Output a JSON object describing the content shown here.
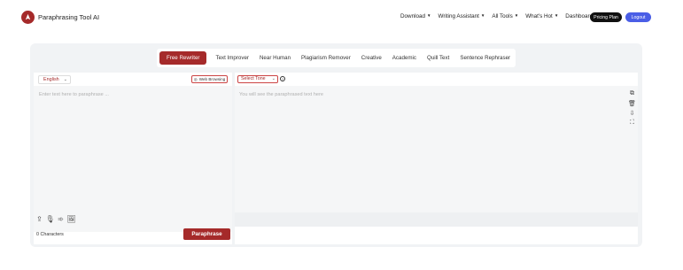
{
  "brand": {
    "name": "Paraphrasing Tool AI"
  },
  "nav": {
    "links": [
      {
        "label": "Download",
        "dropdown": true
      },
      {
        "label": "Writing Assistant",
        "dropdown": true
      },
      {
        "label": "All Tools",
        "dropdown": true
      },
      {
        "label": "What's Hot",
        "dropdown": true
      },
      {
        "label": "Dashboard",
        "dropdown": false
      }
    ],
    "pricing_label": "Pricing Plan",
    "logout_label": "Logout"
  },
  "modes": [
    "Free Rewriter",
    "Text Improver",
    "Near Human",
    "Plagiarism Remover",
    "Creative",
    "Academic",
    "Quill Text",
    "Sentence Rephraser"
  ],
  "active_mode": "Free Rewriter",
  "input": {
    "language": "English",
    "web_browsing_label": "Web Browsing",
    "placeholder": "Enter text here to paraphrase ...",
    "char_count": "0 Characters",
    "paraphrase_label": "Paraphrase"
  },
  "output": {
    "tone_label": "Select Tone",
    "placeholder": "You will see the paraphrased text here"
  },
  "colors": {
    "accent": "#a52a2a",
    "logout": "#4a5ee6",
    "pricing": "#111111"
  },
  "icons": {
    "input_tools": [
      "upload-icon",
      "microphone-icon",
      "arrow-right-icon",
      "image-icon"
    ],
    "output_tools": [
      "copy-icon",
      "trash-icon",
      "download-icon",
      "expand-icon"
    ]
  }
}
